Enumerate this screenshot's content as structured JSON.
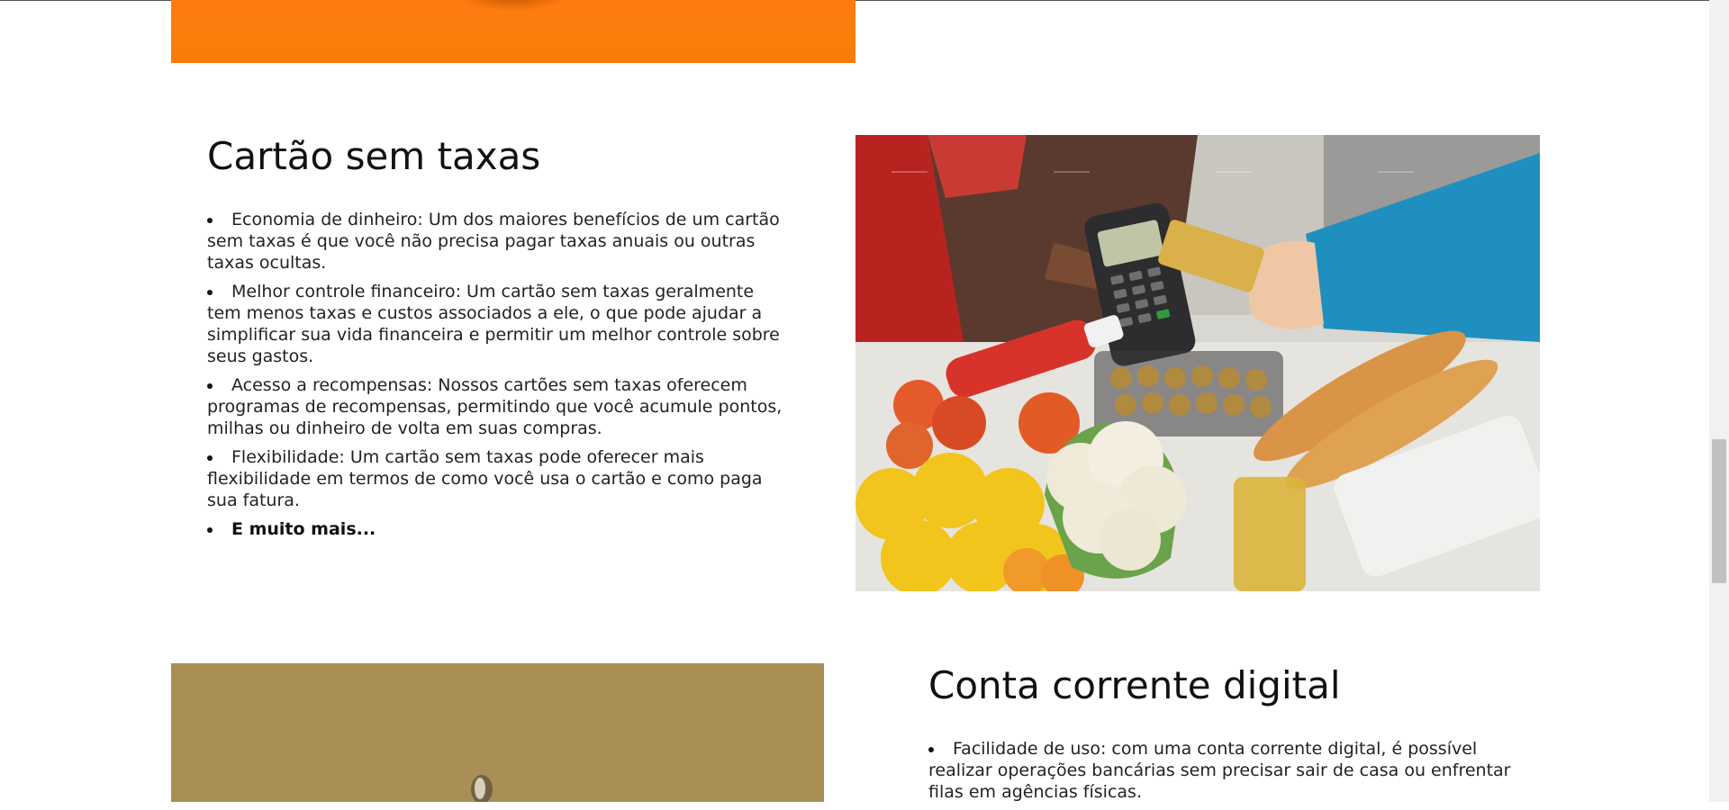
{
  "section_card": {
    "title": "Cartão sem taxas",
    "items": [
      "Economia de dinheiro: Um dos maiores benefícios de um cartão sem taxas é que você não precisa pagar taxas anuais ou outras taxas ocultas.",
      "Melhor controle financeiro: Um cartão sem taxas geralmente tem menos taxas e custos associados a ele, o que pode ajudar a simplificar sua vida financeira e permitir um melhor controle sobre seus gastos.",
      "Acesso a recompensas: Nossos cartões sem taxas oferecem programas de recompensas, permitindo que você acumule pontos, milhas ou dinheiro de volta em suas compras.",
      "Flexibilidade: Um cartão sem taxas pode oferecer mais flexibilidade em termos de como você usa o cartão e como paga sua fatura.",
      "E muito mais..."
    ]
  },
  "section_account": {
    "title": "Conta corrente digital",
    "items": [
      "Facilidade de uso: com uma conta corrente digital, é possível realizar operações bancárias sem precisar sair de casa ou enfrentar filas em agências físicas."
    ]
  },
  "colors": {
    "banner_orange": "#fb7f0c",
    "photo2_olive": "#a98f55"
  },
  "icons": {
    "bullet": "bullet-dot-icon"
  }
}
